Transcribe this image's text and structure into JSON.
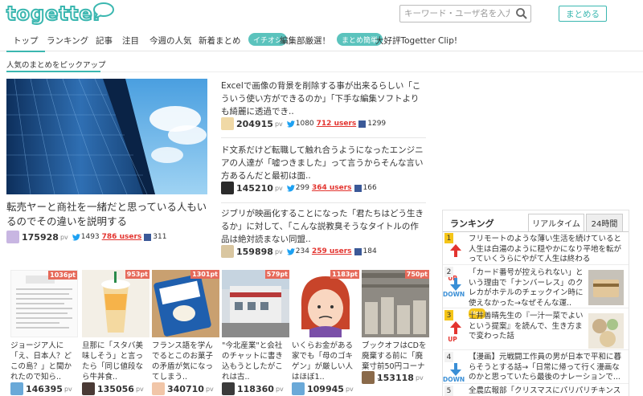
{
  "header": {
    "logo_text": "togetter",
    "search_placeholder": "キーワード・ユーザ名を入力",
    "matome_button": "まとめる"
  },
  "nav": {
    "items": [
      "トップ",
      "ランキング",
      "記事",
      "注目",
      "今週の人気",
      "新着まとめ"
    ],
    "promo1_pill": "イチオシ",
    "promo1_text": "編集部厳選！",
    "promo2_pill": "まとめ簡単",
    "promo2_text": "大好評Togetter Clip!"
  },
  "section_title": "人気のまとめをピックアップ",
  "featured": {
    "title": "転売ヤーと商社を一緒だと思っている人もいるのでその違いを説明する",
    "pv": "175928",
    "pv_unit": "pv",
    "tweets": "1493",
    "users": "786 users",
    "fb": "311"
  },
  "list": [
    {
      "title": "Excelで画像の背景を削除する事が出来るらしい「こういう使い方ができるのか」「下手な編集ソフトよりも綺麗に透過でき..",
      "pv": "204915",
      "pv_unit": "pv",
      "tweets": "1080",
      "users": "712 users",
      "fb": "1299"
    },
    {
      "title": "ド文系だけど転職して触れ合うようになったエンジニアの人達が「嘘つきました」って言うからそんな言い方あるんだと最初は面..",
      "pv": "145210",
      "pv_unit": "pv",
      "tweets": "299",
      "users": "364 users",
      "fb": "166"
    },
    {
      "title": "ジブリが映画化することになった「君たちはどう生きるか」に対して、「こんな説教臭そうなタイトルの作品は絶対読まない同盟..",
      "pv": "159898",
      "pv_unit": "pv",
      "tweets": "234",
      "users": "259 users",
      "fb": "184"
    }
  ],
  "cards": [
    {
      "badge": "1036pt",
      "title": "ジョージア人に「え、日本人？どこの島？」と聞かれたので知ら..",
      "pv": "146395",
      "pv_unit": "pv"
    },
    {
      "badge": "953pt",
      "title": "旦那に「スタバ美味しそう」と言ったら「同じ値段なら牛丼食..",
      "pv": "135056",
      "pv_unit": "pv"
    },
    {
      "badge": "1301pt",
      "title": "フランス語を学んでるとこのお菓子の矛盾が気になってしまう..",
      "pv": "340710",
      "pv_unit": "pv"
    },
    {
      "badge": "579pt",
      "title": "\"今北産業\"と会社のチャットに書き込もうとしたがこれは古..",
      "pv": "118360",
      "pv_unit": "pv"
    },
    {
      "badge": "1183pt",
      "title": "いくらお金がある家でも「母のゴキゲン」が厳しい人はほぼ1..",
      "pv": "109945",
      "pv_unit": "pv"
    },
    {
      "badge": "750pt",
      "title": "ブックオフはCDを廃棄する前に「廃棄寸前50円コーナー」..",
      "pv": "153118",
      "pv_unit": "pv"
    }
  ],
  "ranking": {
    "title": "ランキング",
    "tab_realtime": "リアルタイム",
    "tab_24h": "24時間",
    "items": [
      {
        "rank": "1",
        "dir": "UP",
        "title": "フリモートのような薄い生活を続けていると人生は白湯のように穏やかになり平地を転がっていくうらにやがて人生は終わる"
      },
      {
        "rank": "2",
        "dir": "DOWN",
        "title": "「カード番号が控えられない」という理由で「ナンバーレス」のクレカがホテルのチェックイン時に使えなかった→なぜそんな運..",
        "new": "New"
      },
      {
        "rank": "3",
        "dir": "UP",
        "title": "土井善晴先生の『一汁一菜でよいという提案』を読んで、生き方まで変わった話"
      },
      {
        "rank": "4",
        "dir": "DOWN",
        "title": "【漫画】元戦闘工作員の男が日本で平和に暮らそうとする話→「日常に帰って行く漫画なのかと思っていたら最後のナレーションで..."
      },
      {
        "rank": "5",
        "dir": "",
        "title": "全農広報部「クリスマスにパリパリチキンステー"
      }
    ]
  },
  "colors": {
    "accent": "#3bb7b0",
    "users_red": "#e3342f",
    "badge_red": "#e66a5a",
    "rank_gold": "#f5c518",
    "up_red": "#e3342f",
    "down_blue": "#3a8fd6"
  }
}
